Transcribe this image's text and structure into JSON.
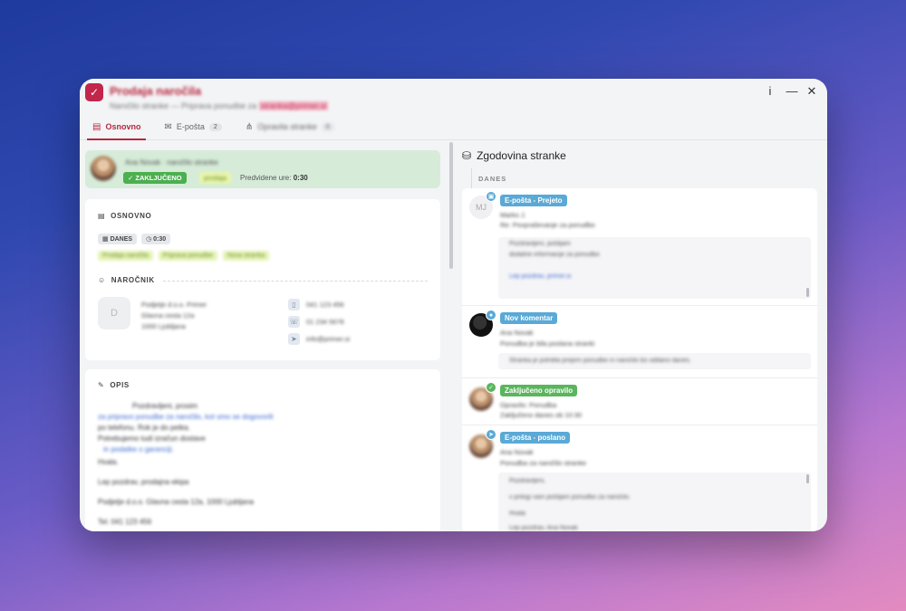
{
  "window": {
    "title": "Prodaja naročila",
    "subtitle": "Naročilo stranke — Priprava ponudbe za",
    "subtitle_highlight": "stranka@primer.si",
    "controls": {
      "info": "i",
      "minimize": "—",
      "close": "✕"
    }
  },
  "tabs": [
    {
      "icon": "document-icon",
      "label": "Osnovno",
      "active": true,
      "count": ""
    },
    {
      "icon": "mail-icon",
      "label": "E-pošta",
      "active": false,
      "count": "2"
    },
    {
      "icon": "tree-icon",
      "label": "Opravila stranke",
      "active": false,
      "count": "0"
    }
  ],
  "status": {
    "name": "Ana Novak · naročilo stranke",
    "done_label": "ZAKLJUČENO",
    "tag": "prodaja",
    "estimate_label": "Predvidene ure:",
    "estimate_value": "0:30"
  },
  "basic": {
    "heading": "OSNOVNO",
    "date_chip": "DANES",
    "time_chip": "0:30",
    "tags": [
      "Prodaja naročila",
      "Priprava ponudbe",
      "Nova stranka"
    ],
    "client_heading": "NAROČNIK",
    "client_initial": "D",
    "client_lines": [
      "Podjetje d.o.o. Primer",
      "Glavna cesta 12a",
      "1000 Ljubljana"
    ],
    "contact_lines": [
      "041 123 456",
      "01 234 5678",
      "info@primer.si"
    ]
  },
  "description": {
    "heading": "OPIS",
    "lines": [
      "Pozdravljeni, prosim",
      "za pripravo ponudbe za naročilo, kot smo se dogovorili",
      "po telefonu. Rok je do petka.",
      "Potrebujemo tudi izračun dostave",
      "in podatke o garanciji.",
      "Hvala.",
      "Lep pozdrav, prodajna ekipa",
      "Podjetje d.o.o. Glavna cesta 12a, 1000 Ljubljana",
      "Tel. 041 123 456"
    ]
  },
  "history": {
    "title": "Zgodovina stranke",
    "today": "DANES",
    "entries": [
      {
        "type": "E-pošta - Prejeto",
        "initials": "MJ",
        "lines": [
          "Marko J.",
          "Re: Povpraševanje za ponudbo"
        ],
        "quote": [
          "Pozdravljeni, pošiljam",
          "dodatne informacije za ponudbo",
          "",
          "Lep pozdrav, primer.si"
        ]
      },
      {
        "type": "Nov komentar",
        "lines": [
          "Ana Novak",
          "Ponudba je bila poslana stranki"
        ],
        "quote": [
          "Stranka je potrdila prejem ponudbe in naročilo bo oddano danes."
        ]
      },
      {
        "type": "Zaključeno opravilo",
        "lines": [
          "Opravilo: Ponudba",
          "Zaključeno danes ob 10:30"
        ]
      },
      {
        "type": "E-pošta - poslano",
        "lines": [
          "Ana Novak",
          "Ponudba za naročilo stranke"
        ],
        "quote": [
          "Pozdravljeni,",
          "v prilogi vam pošiljam ponudbo za naročilo.",
          "Hvala",
          "Lep pozdrav, Ana Novak"
        ]
      }
    ]
  },
  "colors": {
    "accent": "#b7283f",
    "success": "#4caf50",
    "info": "#5aa9d6",
    "status_card": "#d6ecd9"
  }
}
